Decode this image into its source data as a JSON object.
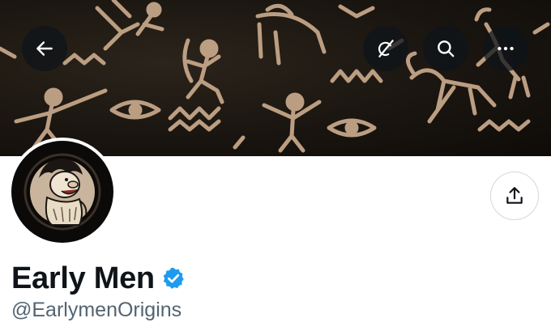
{
  "header": {
    "back_icon": "arrow-left-icon",
    "grok_icon": "grok-icon",
    "search_icon": "search-icon",
    "more_icon": "more-icon"
  },
  "banner": {
    "description_icon": "cave-painting-banner"
  },
  "profile": {
    "display_name": "Early Men",
    "verified": true,
    "handle": "@EarlymenOrigins",
    "share_icon": "share-icon"
  },
  "colors": {
    "verified_blue": "#1d9bf0",
    "handle_gray": "#536471",
    "banner_paint": "#c9a98b"
  }
}
